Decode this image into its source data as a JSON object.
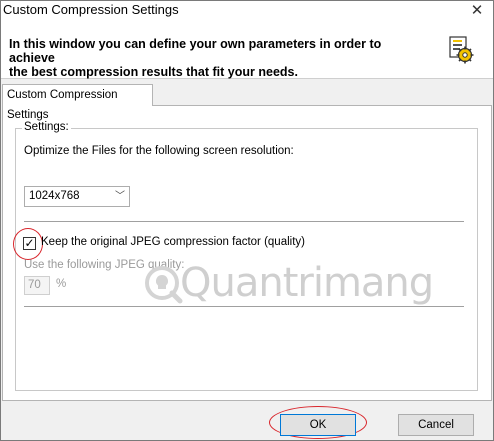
{
  "window": {
    "title": "Custom Compression Settings"
  },
  "banner": {
    "line1": "In this window you can define your own parameters in order to achieve",
    "line2": "the best compression results that fit your needs."
  },
  "tabs": [
    {
      "label": "Custom Compression Settings"
    }
  ],
  "settings": {
    "group_label": "Settings:",
    "resolution_label": "Optimize the Files for the following screen resolution:",
    "resolution_value": "1024x768",
    "keep_jpeg_label": "Keep the original JPEG compression factor (quality)",
    "keep_jpeg_checked": true,
    "quality_label": "Use the following JPEG quality:",
    "quality_value": "70",
    "quality_unit": "%"
  },
  "watermark": "Quantrimang",
  "buttons": {
    "ok": "OK",
    "cancel": "Cancel"
  },
  "colors": {
    "annotation_red": "#d9262c",
    "default_button_border": "#0078d7"
  }
}
